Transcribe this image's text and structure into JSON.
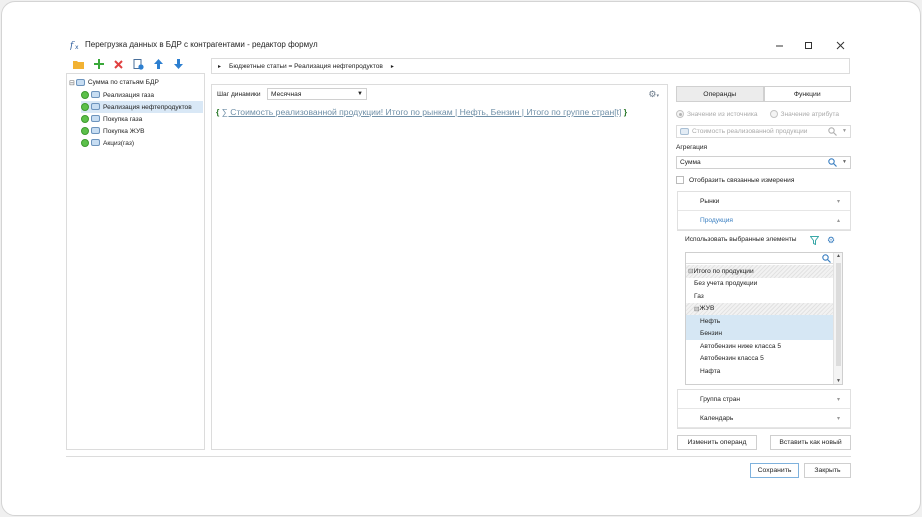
{
  "window": {
    "title": "Перегрузка данных в БДР с контрагентами - редактор формул"
  },
  "toolbar": {
    "icons": [
      "folder-icon",
      "add-icon",
      "delete-icon",
      "document-icon",
      "arrow-up-icon",
      "arrow-down-icon"
    ]
  },
  "tree": {
    "root_label": "Сумма по статьям БДР",
    "items": [
      {
        "label": "Реализация газа",
        "selected": false
      },
      {
        "label": "Реализация нефтепродуктов",
        "selected": true
      },
      {
        "label": "Покупка газа",
        "selected": false
      },
      {
        "label": "Покупка ЖУВ",
        "selected": false
      },
      {
        "label": "Акциз(газ)",
        "selected": false
      }
    ]
  },
  "breadcrumb": {
    "text": "Бюджетные статьи = Реализация нефтепродуктов"
  },
  "editor": {
    "step_label": "Шаг динамики",
    "step_value": "Месячная",
    "formula_open": "{",
    "formula_close": "}",
    "formula_text": "∑ Стоимость реализованной продукции! Итого по рынкам | Нефть, Бензин | Итого по группе стран[t]"
  },
  "right_panel": {
    "tabs": [
      {
        "label": "Операнды",
        "active": true
      },
      {
        "label": "Функции",
        "active": false
      }
    ],
    "radio_source": "Значение из источника",
    "radio_attribute": "Значение атрибута",
    "source_field": "Стоимость реализованной продукции",
    "aggregation_label": "Агрегация",
    "aggregation_value": "Сумма",
    "show_related_label": "Отобразить связанные измерения",
    "dimensions": {
      "markets": "Рынки",
      "products": "Продукция",
      "country_group": "Группа стран",
      "calendar": "Календарь"
    },
    "use_selected_label": "Использовать выбранные элементы",
    "product_list": [
      {
        "label": "Итого по продукции",
        "prefix": "⊟",
        "style": "hatch",
        "indent": 0
      },
      {
        "label": "Без учета продукции",
        "prefix": "",
        "style": "",
        "indent": 1
      },
      {
        "label": "Газ",
        "prefix": "",
        "style": "",
        "indent": 1
      },
      {
        "label": "ЖУВ",
        "prefix": "⊟",
        "style": "hatch",
        "indent": 1
      },
      {
        "label": "Нефть",
        "prefix": "",
        "style": "sel",
        "indent": 2
      },
      {
        "label": "Бензин",
        "prefix": "",
        "style": "sel",
        "indent": 2
      },
      {
        "label": "Автобензин ниже класса 5",
        "prefix": "",
        "style": "",
        "indent": 2
      },
      {
        "label": "Автобензин класса 5",
        "prefix": "",
        "style": "",
        "indent": 2
      },
      {
        "label": "Нафта",
        "prefix": "",
        "style": "",
        "indent": 2
      }
    ],
    "change_operand": "Изменить операнд",
    "insert_new": "Вставить как новый"
  },
  "footer": {
    "save": "Сохранить",
    "close": "Закрыть"
  },
  "colors": {
    "accent": "#3a7fc1",
    "selection": "#d9e8f6",
    "formula_brace": "#2c7a2c",
    "status_green": "#5cc04a"
  }
}
